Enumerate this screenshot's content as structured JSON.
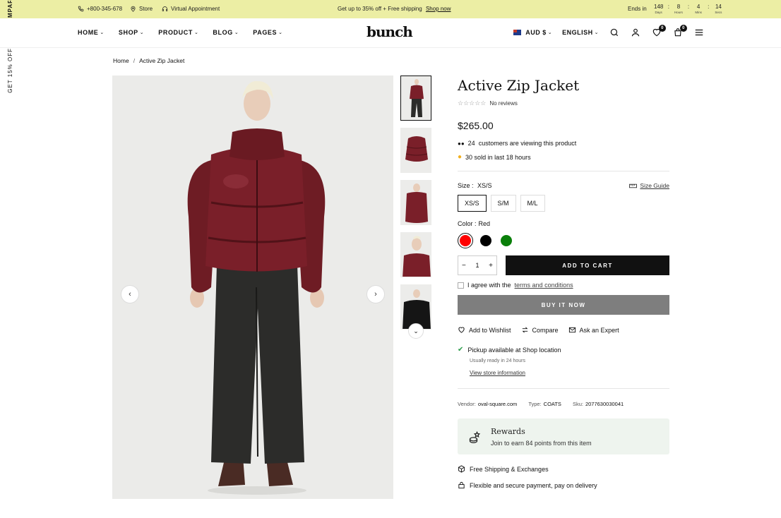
{
  "topbar": {
    "phone": "+800-345-678",
    "store": "Store",
    "appointment": "Virtual Appointment",
    "promo": "Get up to 35% off + Free shipping",
    "promo_link": "Shop now",
    "ends_in": "Ends in",
    "countdown": [
      {
        "value": "148",
        "label": "Days"
      },
      {
        "value": "8",
        "label": "Hours"
      },
      {
        "value": "4",
        "label": "Mins"
      },
      {
        "value": "14",
        "label": "Secs"
      }
    ]
  },
  "side": {
    "compare": "MPARE",
    "offer": "GET 15% OFF"
  },
  "nav": [
    {
      "label": "HOME"
    },
    {
      "label": "SHOP"
    },
    {
      "label": "PRODUCT"
    },
    {
      "label": "BLOG"
    },
    {
      "label": "PAGES"
    }
  ],
  "logo": "bunch",
  "header_right": {
    "currency": "AUD $",
    "language": "ENGLISH",
    "wishlist_count": "0",
    "cart_count": "0"
  },
  "breadcrumb": {
    "home": "Home",
    "sep": "/",
    "current": "Active Zip Jacket"
  },
  "product": {
    "title": "Active Zip Jacket",
    "stars": "☆☆☆☆☆",
    "reviews": "No reviews",
    "price": "$265.00",
    "viewing_count": "24",
    "viewing_text": "customers are viewing this product",
    "sold_text": "30 sold in last 18 hours",
    "size_label": "Size :",
    "size_selected": "XS/S",
    "size_guide": "Size Guide",
    "sizes": [
      "XS/S",
      "S/M",
      "M/L"
    ],
    "color_label": "Color :",
    "color_selected": "Red",
    "colors": [
      "#ff0000",
      "#000000",
      "#0a7f0a"
    ],
    "qty": "1",
    "add_to_cart": "ADD TO CART",
    "agree_text": "I agree with the",
    "terms": "terms and conditions",
    "buy_now": "BUY IT NOW",
    "wishlist": "Add to Wishlist",
    "compare": "Compare",
    "ask": "Ask an Expert",
    "pickup": "Pickup available at Shop location",
    "pickup_sub": "Usually ready in 24 hours",
    "store_info": "View store information",
    "vendor_label": "Vendor:",
    "vendor": "oval-square.com",
    "type_label": "Type:",
    "type": "COATS",
    "sku_label": "Sku:",
    "sku": "2077630030041",
    "rewards_title": "Rewards",
    "rewards_sub": "Join to earn 84 points from this item",
    "feature1": "Free Shipping & Exchanges",
    "feature2": "Flexible and secure payment, pay on delivery"
  }
}
